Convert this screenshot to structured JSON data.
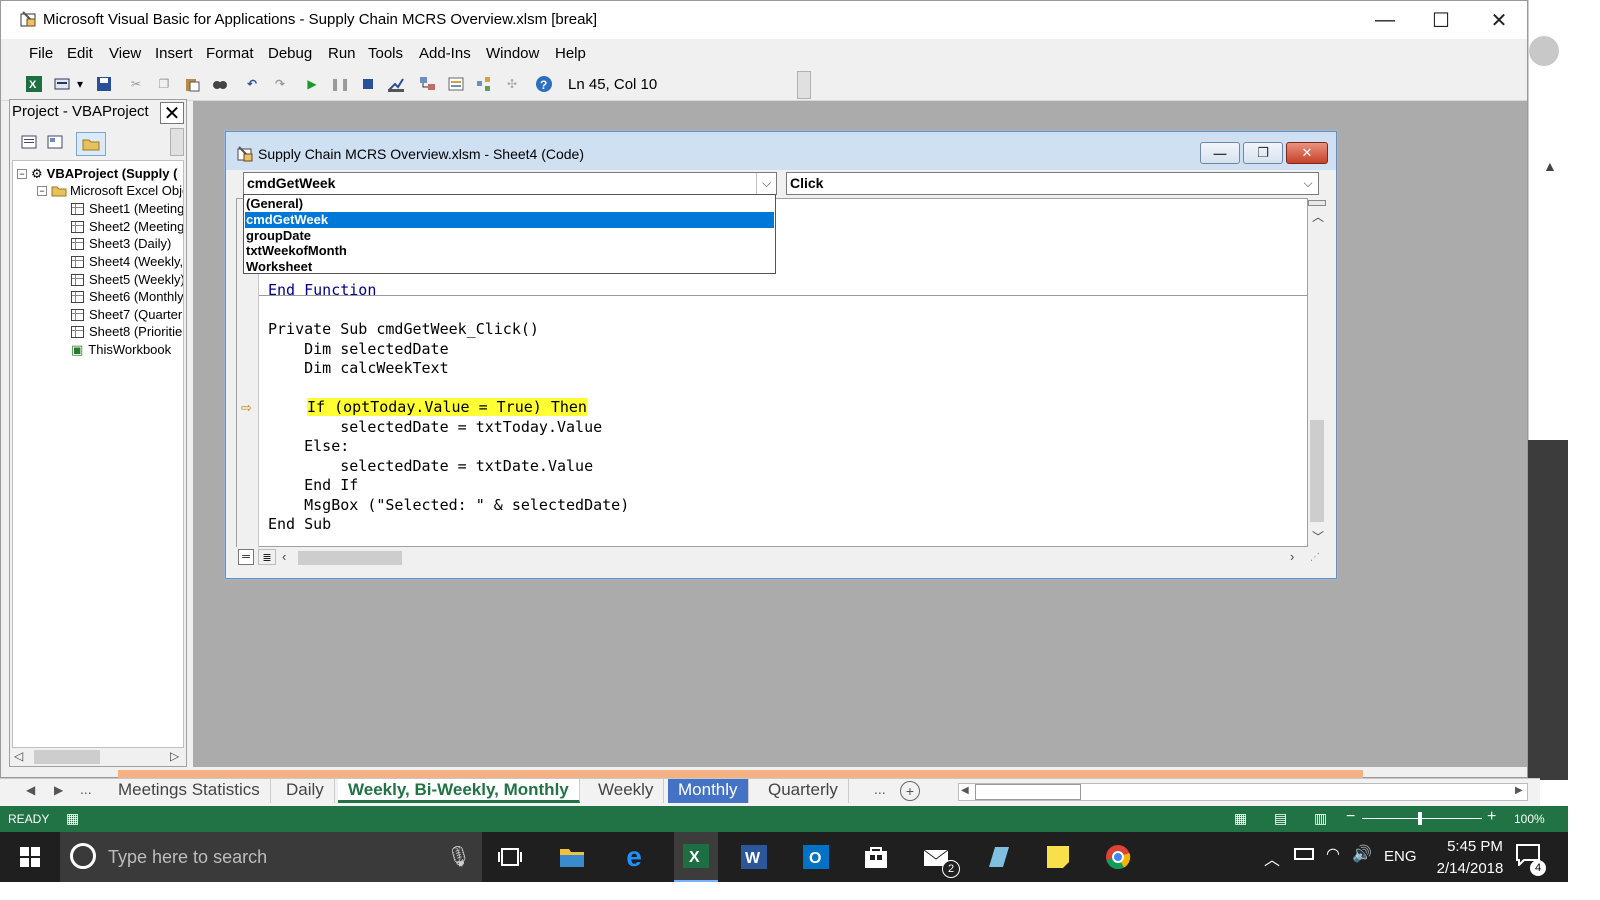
{
  "window": {
    "title": "Microsoft Visual Basic for Applications - Supply Chain MCRS Overview.xlsm [break]",
    "minimize": "—",
    "maximize": "☐",
    "close": "✕"
  },
  "menu": [
    "File",
    "Edit",
    "View",
    "Insert",
    "Format",
    "Debug",
    "Run",
    "Tools",
    "Add-Ins",
    "Window",
    "Help"
  ],
  "toolbar": {
    "position": "Ln 45, Col 10",
    "icons": [
      "excel-icon",
      "insert-module-icon",
      "save-icon",
      "cut-icon",
      "copy-icon",
      "paste-icon",
      "find-icon",
      "undo-icon",
      "redo-icon",
      "run-icon",
      "break-icon",
      "reset-icon",
      "design-mode-icon",
      "project-explorer-icon",
      "properties-icon",
      "object-browser-icon",
      "toolbox-icon",
      "help-icon"
    ]
  },
  "project": {
    "title": "Project - VBAProject",
    "close": "✕",
    "root": "VBAProject (Supply (",
    "folder": "Microsoft Excel Obje",
    "items": [
      "Sheet1 (Meeting",
      "Sheet2 (Meeting",
      "Sheet3 (Daily)",
      "Sheet4 (Weekly,",
      "Sheet5 (Weekly)",
      "Sheet6 (Monthly)",
      "Sheet7 (Quarterl",
      "Sheet8 (Prioritie",
      "ThisWorkbook"
    ]
  },
  "codewindow": {
    "title": "Supply Chain MCRS Overview.xlsm - Sheet4 (Code)",
    "object_combo": "cmdGetWeek",
    "proc_combo": "Click",
    "dropdown": [
      "(General)",
      "cmdGetWeek",
      "groupDate",
      "txtWeekofMonth",
      "Worksheet"
    ],
    "selected_index": 1,
    "lines": [
      "End Function",
      "",
      "Private Sub cmdGetWeek_Click()",
      "    Dim selectedDate",
      "    Dim calcWeekText",
      "",
      "    If (optToday.Value = True) Then",
      "        selectedDate = txtToday.Value",
      "    Else:",
      "        selectedDate = txtDate.Value",
      "    End If",
      "    MsgBox (\"Selected: \" & selectedDate)",
      "End Sub"
    ],
    "highlight_line": 6
  },
  "excel": {
    "tabs": [
      "Meetings Statistics",
      "Daily",
      "Weekly, Bi-Weekly, Monthly",
      "Weekly",
      "Monthly",
      "Quarterly"
    ],
    "active_tab": "Weekly, Bi-Weekly, Monthly",
    "colored_tab": "Monthly",
    "more": "...",
    "status": "READY",
    "zoom": "100%",
    "zoom_minus": "−",
    "zoom_plus": "+"
  },
  "taskbar": {
    "search_placeholder": "Type here to search",
    "lang": "ENG",
    "time": "5:45 PM",
    "date": "2/14/2018",
    "notifications": "4",
    "mail_badge": "2"
  },
  "colors": {
    "excel_green": "#217346",
    "highlight": "#ffff33",
    "selection": "#0078d7"
  }
}
